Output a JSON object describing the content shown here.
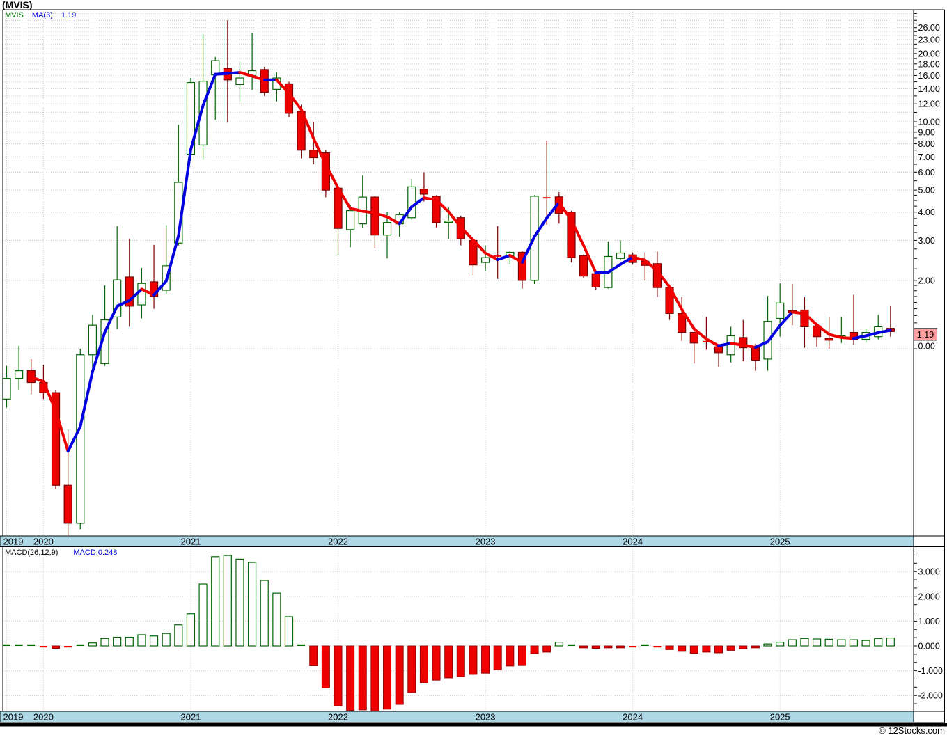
{
  "header": {
    "title": "(MVIS)"
  },
  "legend": {
    "symbol": "MVIS",
    "ma_label": "MA(3)",
    "ma_value": "1.19"
  },
  "footer": {
    "watermark": "© 12Stocks.com"
  },
  "colors": {
    "up": "#006600",
    "up_wick": "#006600",
    "down": "#EE0000",
    "down_border": "#7B0000",
    "ma_up": "#0000E0",
    "ma_down": "#EE0000",
    "grid": "#C9C9C9",
    "frame": "#000000",
    "band": "#AFD8E6",
    "badge_bg": "#FF9E9E",
    "macd_pos": "#006600",
    "macd_neg": "#EE0000",
    "macd_neg_border": "#990000"
  },
  "chart_data": {
    "type": "candlestick",
    "symbol": "MVIS",
    "timeframe": "monthly",
    "price_scale": "log",
    "title": "(MVIS)",
    "legend_entries": [
      "MVIS",
      "MA(3)",
      "1.19"
    ],
    "last_price": "1.19",
    "x_years": [
      "2019",
      "2020",
      "2021",
      "2022",
      "2023",
      "2024",
      "2025"
    ],
    "year_candle_indices": [
      0,
      3,
      15,
      27,
      39,
      51,
      63
    ],
    "price_axis_labels": [
      {
        "p": 26,
        "t": "26.00"
      },
      {
        "p": 23,
        "t": "23.00"
      },
      {
        "p": 20,
        "t": "20.00"
      },
      {
        "p": 18,
        "t": "18.00"
      },
      {
        "p": 16,
        "t": "16.00"
      },
      {
        "p": 14,
        "t": "14.00"
      },
      {
        "p": 12,
        "t": "12.00"
      },
      {
        "p": 10,
        "t": "10.00"
      },
      {
        "p": 9,
        "t": "9.00"
      },
      {
        "p": 8,
        "t": "8.00"
      },
      {
        "p": 7,
        "t": "7.00"
      },
      {
        "p": 6,
        "t": "6.00"
      },
      {
        "p": 5,
        "t": "5.00"
      },
      {
        "p": 4,
        "t": "4.00"
      },
      {
        "p": 3,
        "t": "3.00"
      },
      {
        "p": 2,
        "t": "2.00"
      },
      {
        "p": 1.03,
        "t": "0.00"
      }
    ],
    "candles_ohlc": [
      [
        0.6,
        0.84,
        0.55,
        0.74
      ],
      [
        0.74,
        1.03,
        0.66,
        0.8
      ],
      [
        0.8,
        0.9,
        0.63,
        0.71
      ],
      [
        0.71,
        0.85,
        0.6,
        0.64
      ],
      [
        0.64,
        0.66,
        0.24,
        0.25
      ],
      [
        0.25,
        0.44,
        0.15,
        0.17
      ],
      [
        0.17,
        1.0,
        0.16,
        0.94
      ],
      [
        0.94,
        1.41,
        0.82,
        1.27
      ],
      [
        0.86,
        1.9,
        0.84,
        1.34
      ],
      [
        1.38,
        3.47,
        1.22,
        2.01
      ],
      [
        2.07,
        3.05,
        1.25,
        1.54
      ],
      [
        1.56,
        2.27,
        1.36,
        1.94
      ],
      [
        1.97,
        2.87,
        1.5,
        1.7
      ],
      [
        1.81,
        3.5,
        1.75,
        2.32
      ],
      [
        2.92,
        9.7,
        2.85,
        5.41
      ],
      [
        7.2,
        15.6,
        6.7,
        14.9
      ],
      [
        7.9,
        24.3,
        6.8,
        15.1
      ],
      [
        16.1,
        19.3,
        10.2,
        18.6
      ],
      [
        17.2,
        28.0,
        9.9,
        15.3
      ],
      [
        14.6,
        18.4,
        12.3,
        15.6
      ],
      [
        16.0,
        24.6,
        13.8,
        16.8
      ],
      [
        17.0,
        17.5,
        13.0,
        13.5
      ],
      [
        13.9,
        16.5,
        12.3,
        15.6
      ],
      [
        14.7,
        15.0,
        10.5,
        10.9
      ],
      [
        11.1,
        11.9,
        6.9,
        7.5
      ],
      [
        7.5,
        10.0,
        6.5,
        6.95
      ],
      [
        7.3,
        7.5,
        4.65,
        5.0
      ],
      [
        5.1,
        5.2,
        2.57,
        3.39
      ],
      [
        3.35,
        4.3,
        2.8,
        4.06
      ],
      [
        3.55,
        5.8,
        3.4,
        4.66
      ],
      [
        4.66,
        4.7,
        2.77,
        3.17
      ],
      [
        3.17,
        4.0,
        2.5,
        3.6
      ],
      [
        3.55,
        4.0,
        3.12,
        3.9
      ],
      [
        3.78,
        5.6,
        3.7,
        5.17
      ],
      [
        5.05,
        6.0,
        4.45,
        4.8
      ],
      [
        4.7,
        4.75,
        3.42,
        3.6
      ],
      [
        3.6,
        4.2,
        3.05,
        3.65
      ],
      [
        3.78,
        3.85,
        2.85,
        3.05
      ],
      [
        3.0,
        3.05,
        2.11,
        2.34
      ],
      [
        2.4,
        2.85,
        2.19,
        2.52
      ],
      [
        2.57,
        3.47,
        2.03,
        2.55
      ],
      [
        2.57,
        2.7,
        2.35,
        2.66
      ],
      [
        2.66,
        2.7,
        1.84,
        2.0
      ],
      [
        2.0,
        4.75,
        1.93,
        4.7
      ],
      [
        4.65,
        8.26,
        3.52,
        4.6
      ],
      [
        4.67,
        4.9,
        3.56,
        3.94
      ],
      [
        4.0,
        4.05,
        2.4,
        2.52
      ],
      [
        2.57,
        2.6,
        2.05,
        2.09
      ],
      [
        2.14,
        2.2,
        1.82,
        1.87
      ],
      [
        1.86,
        2.97,
        1.84,
        2.55
      ],
      [
        2.5,
        3.0,
        2.45,
        2.64
      ],
      [
        2.59,
        2.65,
        2.35,
        2.4
      ],
      [
        2.43,
        2.66,
        2.0,
        2.33
      ],
      [
        2.37,
        2.68,
        1.69,
        1.86
      ],
      [
        1.86,
        1.9,
        1.34,
        1.43
      ],
      [
        1.43,
        1.69,
        1.08,
        1.18
      ],
      [
        1.18,
        1.2,
        0.86,
        1.06
      ],
      [
        1.08,
        1.38,
        0.99,
        1.07
      ],
      [
        1.02,
        1.05,
        0.83,
        0.96
      ],
      [
        0.94,
        1.25,
        0.87,
        1.14
      ],
      [
        1.12,
        1.34,
        0.88,
        1.01
      ],
      [
        1.02,
        1.05,
        0.8,
        0.89
      ],
      [
        0.9,
        1.71,
        0.8,
        1.32
      ],
      [
        1.36,
        1.94,
        1.13,
        1.59
      ],
      [
        1.47,
        1.93,
        1.27,
        1.44
      ],
      [
        1.48,
        1.69,
        1.01,
        1.25
      ],
      [
        1.26,
        1.3,
        1.02,
        1.13
      ],
      [
        1.11,
        1.38,
        1.0,
        1.09
      ],
      [
        1.12,
        1.38,
        1.06,
        1.14
      ],
      [
        1.18,
        1.73,
        1.04,
        1.1
      ],
      [
        1.1,
        1.22,
        1.06,
        1.18
      ],
      [
        1.13,
        1.41,
        1.1,
        1.25
      ],
      [
        1.23,
        1.54,
        1.13,
        1.19
      ]
    ],
    "ma3_overlay": {
      "label": "MA(3)",
      "period": 3,
      "last_value": "1.19"
    },
    "macd": {
      "label": "MACD(26,12,9)",
      "value_label": "MACD:0.248",
      "axis_labels": [
        {
          "v": 3,
          "t": "3.000"
        },
        {
          "v": 2,
          "t": "2.000"
        },
        {
          "v": 1,
          "t": "1.000"
        },
        {
          "v": 0,
          "t": "0.000"
        },
        {
          "v": -1,
          "t": "-1.000"
        },
        {
          "v": -2,
          "t": "-2.000"
        }
      ],
      "histogram": [
        0.03,
        0.05,
        0.06,
        -0.02,
        -0.1,
        -0.06,
        0.04,
        0.12,
        0.3,
        0.35,
        0.35,
        0.45,
        0.4,
        0.5,
        0.85,
        1.3,
        2.5,
        3.6,
        3.65,
        3.5,
        3.37,
        2.64,
        2.13,
        1.18,
        0.02,
        -0.8,
        -1.7,
        -2.42,
        -2.6,
        -2.58,
        -2.62,
        -2.55,
        -2.36,
        -1.88,
        -1.49,
        -1.38,
        -1.29,
        -1.24,
        -1.15,
        -1.1,
        -0.96,
        -0.81,
        -0.79,
        -0.31,
        -0.25,
        0.15,
        0.05,
        -0.08,
        -0.1,
        -0.08,
        -0.08,
        -0.06,
        0.02,
        -0.05,
        -0.15,
        -0.22,
        -0.3,
        -0.25,
        -0.28,
        -0.18,
        -0.12,
        -0.08,
        0.08,
        0.15,
        0.25,
        0.3,
        0.28,
        0.27,
        0.25,
        0.25,
        0.22,
        0.3,
        0.32
      ]
    }
  }
}
